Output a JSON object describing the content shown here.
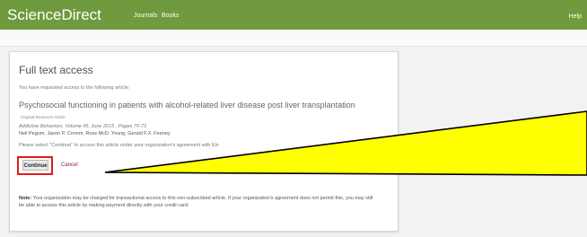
{
  "header": {
    "brand": "ScienceDirect",
    "nav": [
      "Journals",
      "Books"
    ],
    "help": "Help"
  },
  "access": {
    "title": "Full text access",
    "requested": "You have requested access to the following article:",
    "article_title": "Psychosocial functioning in patients with alcohol-related liver disease post liver transplantation",
    "article_type": "Original Research Article",
    "citation": "Addictive Behaviors, Volume 45, June 2015 , Pages 70-73",
    "authors": "Neil Pegum, Jason P. Connor, Ross McD. Young, Gerald F.X. Feeney",
    "instruction": "Please select \"Continue\" to access this article under your organization's agreement with Els",
    "continue_label": "Continue",
    "cancel_label": "Cancel",
    "note_label": "Note:",
    "note_text": " Your organization may be charged for transactional access to this non-subscribed article. If your organization's agreement does not permit this, you may still be able to access this article by making payment directly with your credit card."
  },
  "colors": {
    "header_green": "#6f9a3d",
    "highlight_red": "#e11b1b",
    "callout_yellow": "#ffff00",
    "cancel_link": "#8a1c3b"
  }
}
